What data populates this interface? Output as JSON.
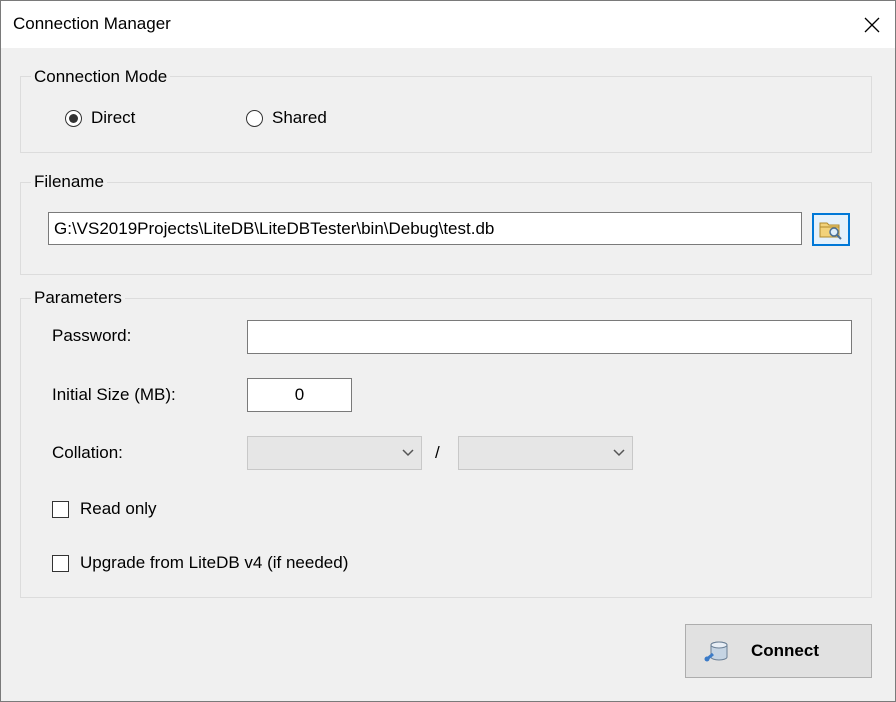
{
  "window": {
    "title": "Connection Manager"
  },
  "connection_mode": {
    "legend": "Connection Mode",
    "options": [
      {
        "label": "Direct",
        "selected": true
      },
      {
        "label": "Shared",
        "selected": false
      }
    ]
  },
  "filename": {
    "legend": "Filename",
    "path": "G:\\VS2019Projects\\LiteDB\\LiteDBTester\\bin\\Debug\\test.db",
    "browse_icon": "folder-search-icon"
  },
  "parameters": {
    "legend": "Parameters",
    "password_label": "Password:",
    "password_value": "",
    "initial_size_label": "Initial Size (MB):",
    "initial_size_value": "0",
    "collation_label": "Collation:",
    "collation_separator": "/",
    "collation_culture": "",
    "collation_options": "",
    "read_only_label": "Read only",
    "read_only_checked": false,
    "upgrade_label": "Upgrade from LiteDB v4 (if needed)",
    "upgrade_checked": false
  },
  "connect": {
    "label": "Connect",
    "icon": "database-connect-icon"
  },
  "colors": {
    "focus_border": "#0078d7",
    "button_face": "#e1e1e1",
    "window_bg": "#f0f0f0"
  }
}
